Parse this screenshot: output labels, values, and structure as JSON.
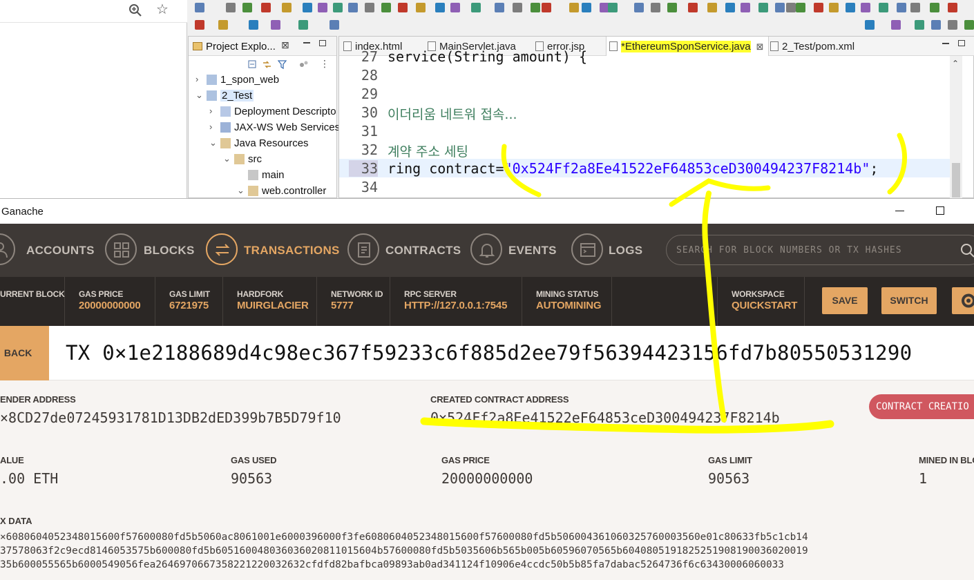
{
  "eclipse": {
    "project_explorer": {
      "title": "Project Explo...",
      "close": "⊠",
      "tree": [
        {
          "label": "1_spon_web",
          "arrow": "›",
          "level": 0
        },
        {
          "label": "2_Test",
          "arrow": "⌄",
          "level": 0
        },
        {
          "label": "Deployment Descripto",
          "arrow": "›",
          "level": 1
        },
        {
          "label": "JAX-WS Web Services",
          "arrow": "›",
          "level": 1
        },
        {
          "label": "Java Resources",
          "arrow": "⌄",
          "level": 1
        },
        {
          "label": "src",
          "arrow": "⌄",
          "level": 2
        },
        {
          "label": "main",
          "arrow": "",
          "level": 3
        },
        {
          "label": "web.controller",
          "arrow": "⌄",
          "level": 3
        }
      ]
    },
    "editor": {
      "tabs": [
        {
          "label": "index.html"
        },
        {
          "label": "MainServlet.java"
        },
        {
          "label": "error.jsp"
        },
        {
          "label": "*EthereumSponService.java",
          "close": "⊠"
        },
        {
          "label": "2_Test/pom.xml"
        }
      ],
      "lines": [
        {
          "num": "27",
          "text": "service(String amount) {"
        },
        {
          "num": "28",
          "text": ""
        },
        {
          "num": "29",
          "text": ""
        },
        {
          "num": "30",
          "text": "이더리움 네트워 접속..."
        },
        {
          "num": "31",
          "text": ""
        },
        {
          "num": "32",
          "text": "계약 주소 세팅"
        },
        {
          "num": "33",
          "text_a": "ring contract=",
          "text_b": "\"0x524Ff2a8Ee41522eF64853ceD300494237F8214b\"",
          "text_c": ";"
        },
        {
          "num": "34",
          "text": ""
        }
      ]
    }
  },
  "ganache": {
    "window_title": "Ganache",
    "nav": [
      {
        "label": "ACCOUNTS"
      },
      {
        "label": "BLOCKS"
      },
      {
        "label": "TRANSACTIONS"
      },
      {
        "label": "CONTRACTS"
      },
      {
        "label": "EVENTS"
      },
      {
        "label": "LOGS"
      }
    ],
    "search_placeholder": "SEARCH FOR BLOCK NUMBERS OR TX HASHES",
    "stats": [
      {
        "label": "URRENT BLOCK",
        "value": ""
      },
      {
        "label": "GAS PRICE",
        "value": "20000000000"
      },
      {
        "label": "GAS LIMIT",
        "value": "6721975"
      },
      {
        "label": "HARDFORK",
        "value": "MUIRGLACIER"
      },
      {
        "label": "NETWORK ID",
        "value": "5777"
      },
      {
        "label": "RPC SERVER",
        "value": "HTTP://127.0.0.1:7545"
      },
      {
        "label": "MINING STATUS",
        "value": "AUTOMINING"
      },
      {
        "label": "WORKSPACE",
        "value": "QUICKSTART"
      }
    ],
    "save_label": "SAVE",
    "switch_label": "SWITCH",
    "back_label": "← BACK",
    "tx_title": "TX 0×1e2188689d4c98ec367f59233c6f885d2ee79f56394423156fd7b80550531290",
    "sender": {
      "label": "ENDER ADDRESS",
      "value": "×8CD27de07245931781D13DB2dED399b7B5D79f10"
    },
    "created_contract": {
      "label": "CREATED CONTRACT ADDRESS",
      "value": "0×524Ff2a8Ee41522eF64853ceD300494237F8214b"
    },
    "contract_creation_badge": "CONTRACT CREATIO",
    "value": {
      "label": "ALUE",
      "value": ".00 ETH"
    },
    "gas_used": {
      "label": "GAS USED",
      "value": "90563"
    },
    "gas_price": {
      "label": "GAS PRICE",
      "value": "20000000000"
    },
    "gas_limit": {
      "label": "GAS LIMIT",
      "value": "90563"
    },
    "mined_in_block": {
      "label": "MINED IN BLO",
      "value": "1"
    },
    "tx_data": {
      "label": "X DATA",
      "lines": [
        "×608060405234801560​0f57600080fd5b5060ac8061001e6000396000f3fe6080604052348015600f57600080fd5b5060043610603257600035​60e01c80633fb5c1cb14",
        "37578063f2c9ecd8146053575b600080fd5b60516004803603602081101560​4b57600080fd5b5035606b565b005b60596070565b6040805191825251908190036020019",
        "35b600055565b6000549056fea2646970667358221220032632cfdfd82bafbca09893ab0ad341124f10906e4ccdc50b5b85fa7dabac5264736f6c63430006060033"
      ]
    }
  },
  "colors": {
    "ganache_accent": "#e4a663",
    "ganache_nav_bg": "#3e3936",
    "ganache_stats_bg": "#2b2725",
    "badge_red": "#d0575f",
    "highlighter": "#ffff30"
  }
}
